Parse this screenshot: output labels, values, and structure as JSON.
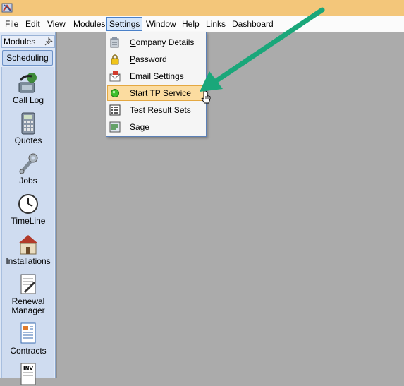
{
  "menubar": {
    "items": [
      {
        "pre": "",
        "mn": "F",
        "post": "ile"
      },
      {
        "pre": "",
        "mn": "E",
        "post": "dit"
      },
      {
        "pre": "",
        "mn": "V",
        "post": "iew"
      },
      {
        "pre": "",
        "mn": "M",
        "post": "odules"
      },
      {
        "pre": "",
        "mn": "S",
        "post": "ettings"
      },
      {
        "pre": "",
        "mn": "W",
        "post": "indow"
      },
      {
        "pre": "",
        "mn": "H",
        "post": "elp"
      },
      {
        "pre": "",
        "mn": "L",
        "post": "inks"
      },
      {
        "pre": "",
        "mn": "D",
        "post": "ashboard"
      }
    ]
  },
  "panel": {
    "title": "Modules",
    "tab": "Scheduling",
    "modules": [
      {
        "label": "Call Log",
        "icon": "call-log-icon"
      },
      {
        "label": "Quotes",
        "icon": "calculator-icon"
      },
      {
        "label": "Jobs",
        "icon": "wrench-icon"
      },
      {
        "label": "TimeLine",
        "icon": "clock-icon"
      },
      {
        "label": "Installations",
        "icon": "house-icon"
      },
      {
        "label": "Renewal Manager",
        "icon": "renewal-document-icon"
      },
      {
        "label": "Contracts",
        "icon": "contract-document-icon"
      },
      {
        "label": "",
        "icon": "invoice-icon"
      }
    ]
  },
  "settings_menu": {
    "items": [
      {
        "mn": "C",
        "rest": "ompany Details",
        "icon": "company-details-icon"
      },
      {
        "mn": "P",
        "rest": "assword",
        "icon": "lock-icon"
      },
      {
        "mn": "E",
        "rest": "mail Settings",
        "icon": "email-settings-icon"
      },
      {
        "mn": "",
        "rest": "Start TP Service",
        "icon": "green-status-icon",
        "highlighted": true
      },
      {
        "mn": "",
        "rest": "Test Result Sets",
        "icon": "list-icon"
      },
      {
        "mn": "",
        "rest": "Sage",
        "icon": "sage-icon"
      }
    ]
  },
  "colors": {
    "arrow": "#1aa77a",
    "highlight": "#fbdca0",
    "titlebar": "#f3c67a"
  }
}
